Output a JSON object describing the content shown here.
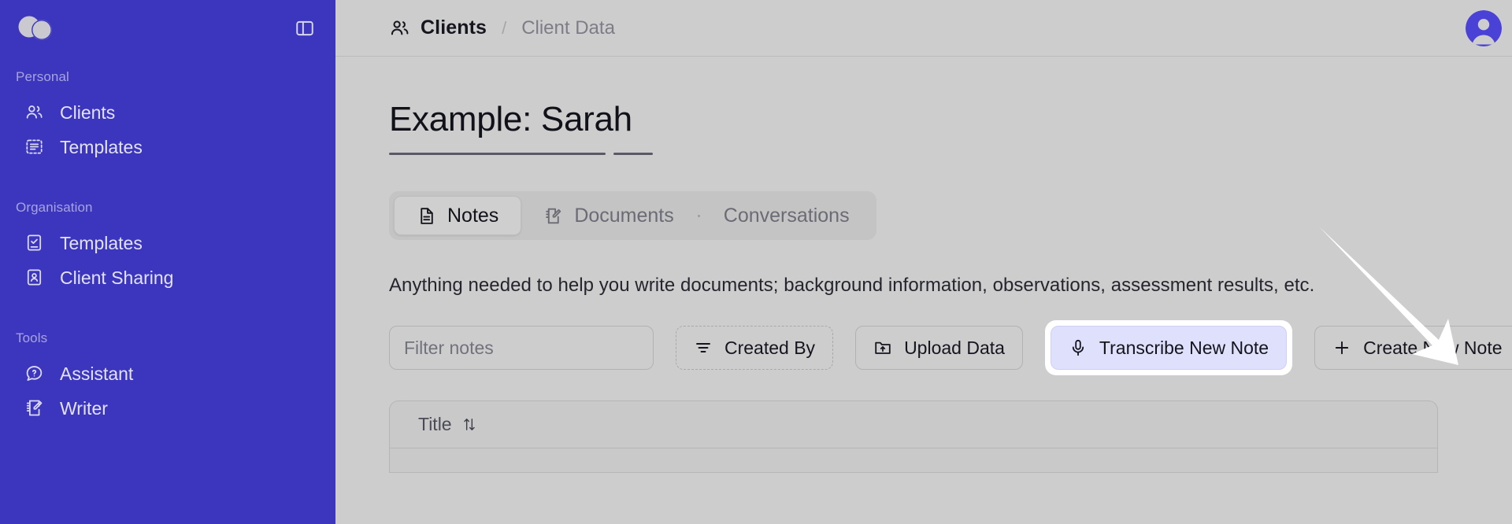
{
  "brand": {
    "sidebar_color": "#3b36bd",
    "accent_button_bg": "#dfe0fb",
    "avatar_color": "#4a41d6"
  },
  "sidebar": {
    "logo_name": "overlapping-circles-logo",
    "toggle_name": "panel-toggle-icon",
    "sections": [
      {
        "heading": "Personal",
        "items": [
          {
            "label": "Clients",
            "icon": "users-icon"
          },
          {
            "label": "Templates",
            "icon": "dashed-list-icon"
          }
        ]
      },
      {
        "heading": "Organisation",
        "items": [
          {
            "label": "Templates",
            "icon": "checked-document-icon"
          },
          {
            "label": "Client Sharing",
            "icon": "id-card-icon"
          }
        ]
      },
      {
        "heading": "Tools",
        "items": [
          {
            "label": "Assistant",
            "icon": "chat-question-icon"
          },
          {
            "label": "Writer",
            "icon": "notebook-pencil-icon"
          }
        ]
      }
    ]
  },
  "topbar": {
    "breadcrumb_icon": "users-icon",
    "breadcrumb_current": "Clients",
    "breadcrumb_separator": "/",
    "breadcrumb_sub": "Client Data",
    "avatar_name": "user-avatar"
  },
  "page": {
    "title": "Example: Sarah",
    "tabs": [
      {
        "label": "Notes",
        "icon": "document-icon",
        "active": true
      },
      {
        "label": "Documents",
        "icon": "document-edit-icon",
        "active": false
      },
      {
        "label": "Conversations",
        "icon": "",
        "active": false
      }
    ],
    "hint": "Anything needed to help you write documents; background information, observations, assessment results, etc."
  },
  "toolbar": {
    "filter_placeholder": "Filter notes",
    "filter_value": "",
    "created_by_label": "Created By",
    "created_by_icon": "filter-lines-icon",
    "upload_label": "Upload Data",
    "upload_icon": "folder-upload-icon",
    "transcribe_label": "Transcribe New Note",
    "transcribe_icon": "microphone-icon",
    "create_label": "Create New Note",
    "create_icon": "plus-icon"
  },
  "table": {
    "columns": [
      {
        "label": "Title",
        "sort_icon": "sort-arrows-icon"
      }
    ],
    "rows": []
  },
  "annotation": {
    "arrow_name": "pointer-arrow",
    "arrow_color": "#ffffff"
  }
}
